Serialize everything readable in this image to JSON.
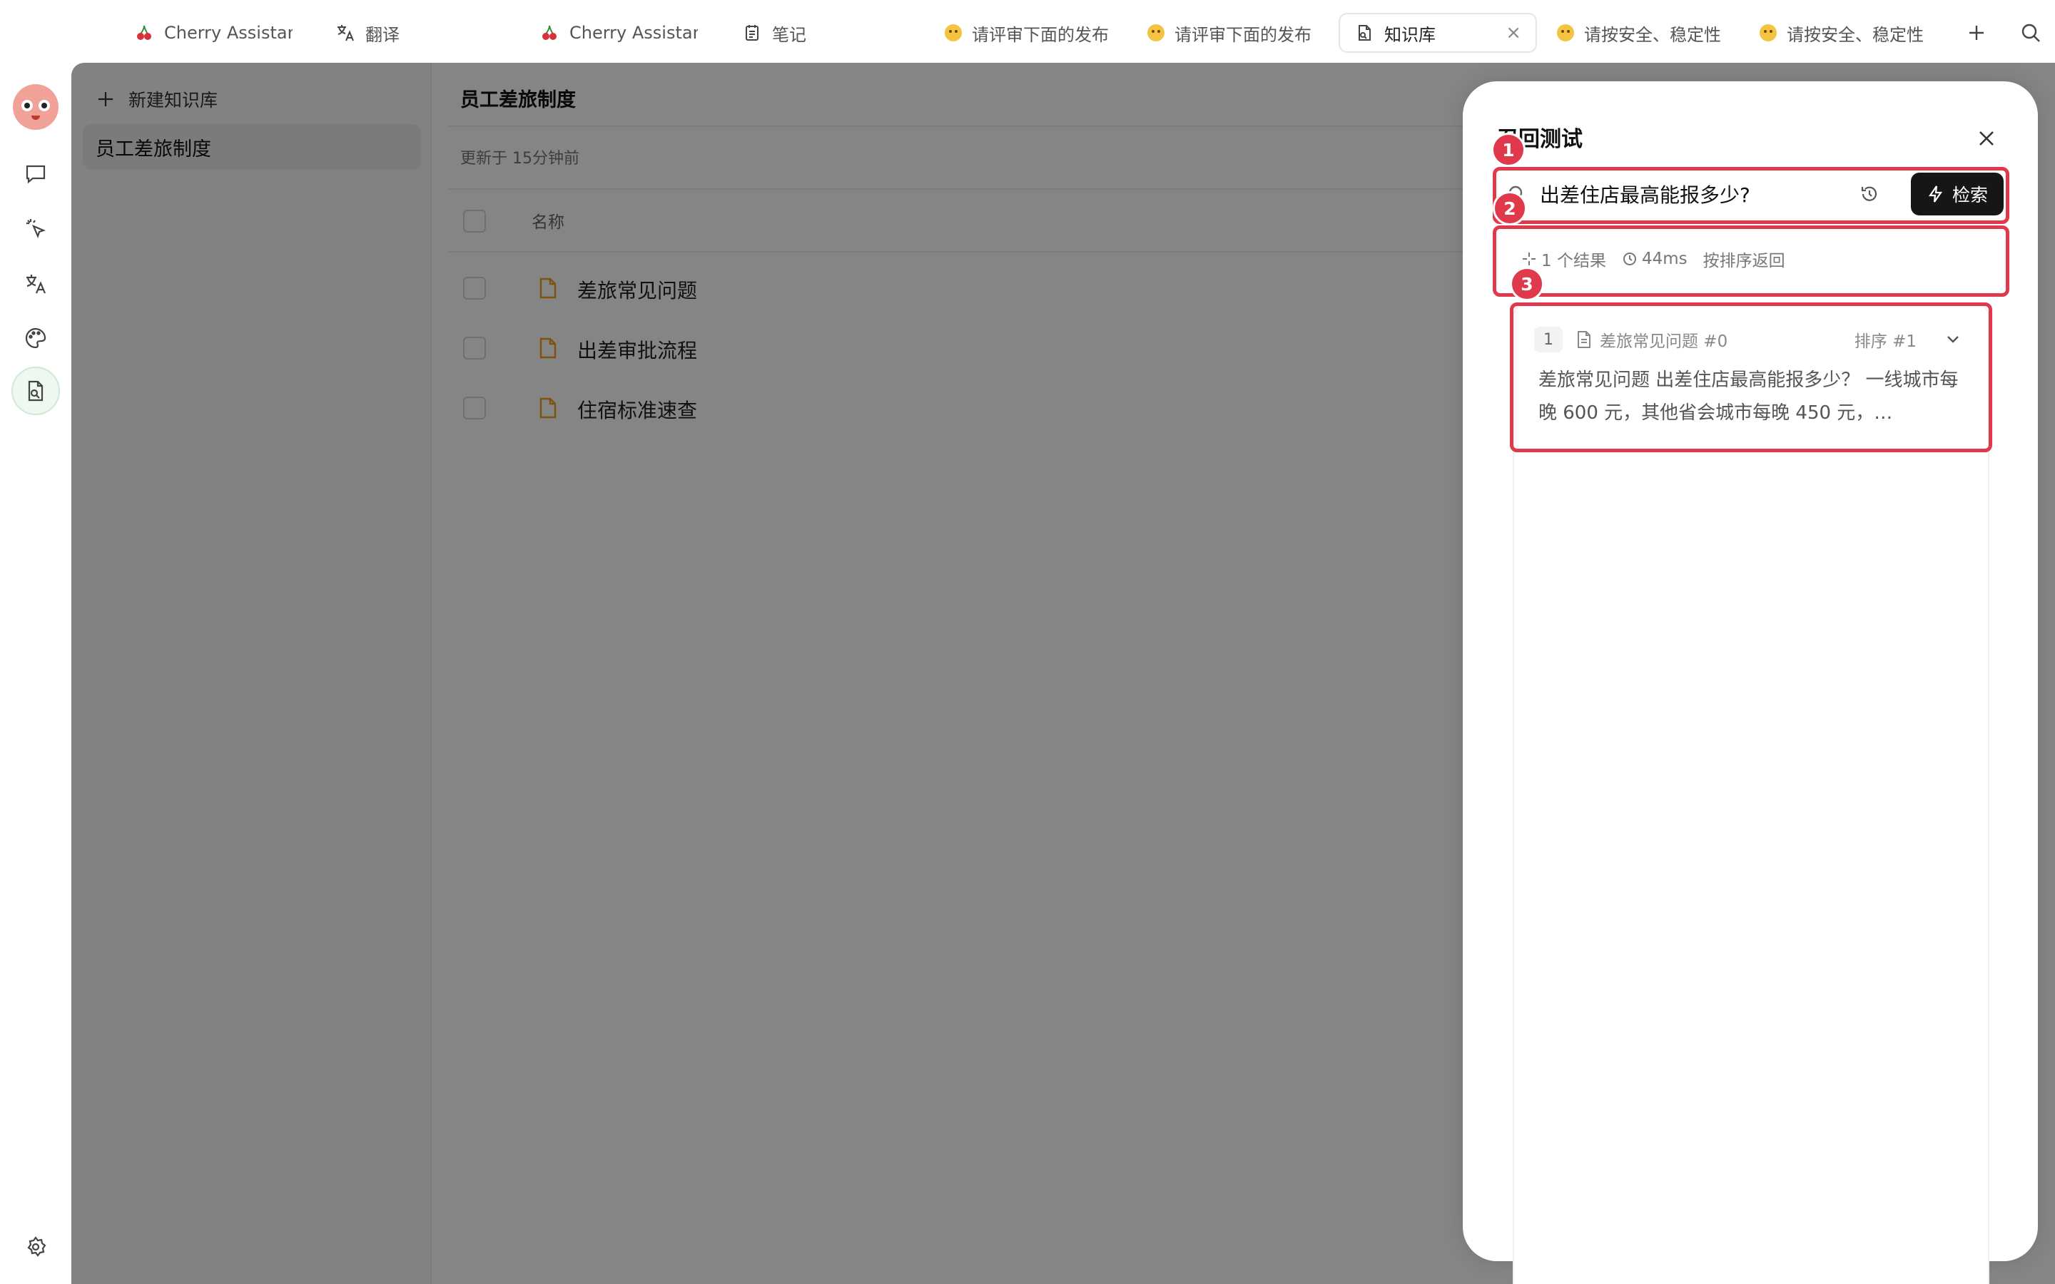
{
  "tabs": [
    {
      "label": "Cherry Assistant",
      "icon": "cherry-icon"
    },
    {
      "label": "翻译",
      "icon": "translate-icon"
    },
    {
      "label": "Cherry Assistant",
      "icon": "cherry-icon"
    },
    {
      "label": "笔记",
      "icon": "notes-icon"
    },
    {
      "label": "请评审下面的发布",
      "icon": "emoji-icon"
    },
    {
      "label": "请评审下面的发布",
      "icon": "emoji-icon"
    },
    {
      "label": "知识库",
      "icon": "knowledge-base-icon",
      "active": true
    },
    {
      "label": "请按安全、稳定性",
      "icon": "emoji-icon"
    },
    {
      "label": "请按安全、稳定性",
      "icon": "emoji-icon"
    }
  ],
  "sidebar": {
    "new_kb_label": "新建知识库",
    "kb_items": [
      "员工差旅制度"
    ]
  },
  "main": {
    "title": "员工差旅制度",
    "updated": "更新于 15分钟前",
    "col_name": "名称",
    "files": [
      "差旅常见问题",
      "出差审批流程",
      "住宿标准速查"
    ]
  },
  "drawer": {
    "title": "召回测试",
    "search_value": "出差住店最高能报多少?",
    "search_button": "检索",
    "stats": {
      "results": "1 个结果",
      "time": "44ms",
      "order": "按排序返回"
    },
    "result": {
      "index": "1",
      "source": "差旅常见问题 #0",
      "rank": "排序 #1",
      "content": "差旅常见问题 出差住店最高能报多少？ 一线城市每晚 600 元，其他省会城市每晚 450 元，…"
    }
  },
  "annotations": [
    "1",
    "2",
    "3"
  ],
  "colors": {
    "accent_red": "#e0394b",
    "button_dark": "#161616",
    "file_icon": "#f0a020"
  }
}
